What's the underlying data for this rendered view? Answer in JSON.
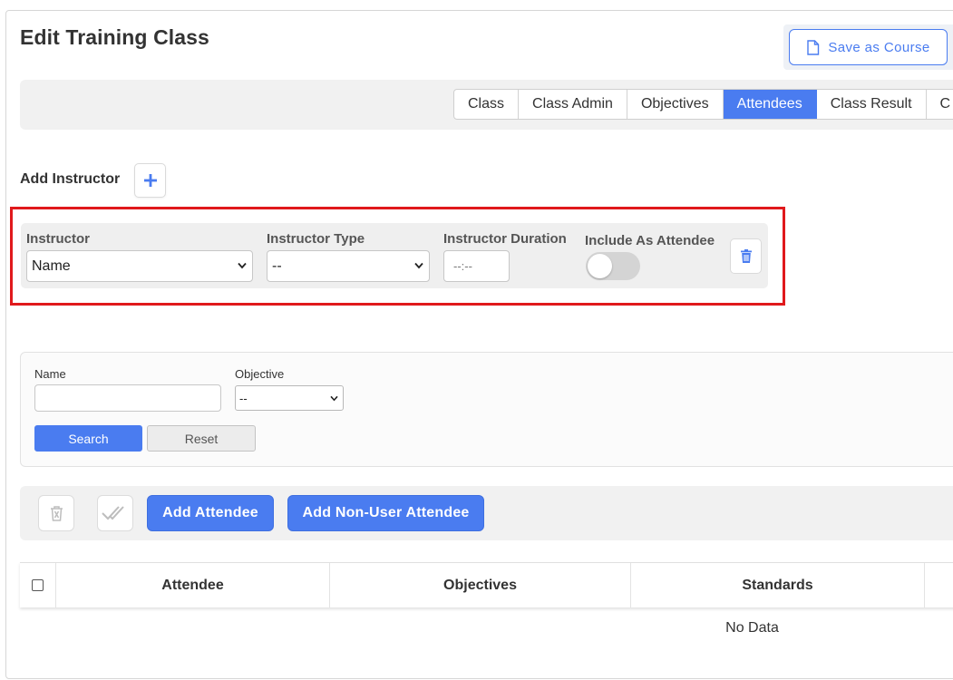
{
  "page": {
    "title": "Edit Training Class",
    "save_as_course_label": "Save as Course"
  },
  "tabs": [
    {
      "label": "Class",
      "active": false
    },
    {
      "label": "Class Admin",
      "active": false
    },
    {
      "label": "Objectives",
      "active": false
    },
    {
      "label": "Attendees",
      "active": true
    },
    {
      "label": "Class Result",
      "active": false
    },
    {
      "label": "C",
      "active": false
    }
  ],
  "instructor_section": {
    "add_label": "Add Instructor",
    "add_icon": "plus-icon",
    "instructor_label": "Instructor",
    "instructor_value": "Name",
    "type_label": "Instructor Type",
    "type_value": "--",
    "duration_label": "Instructor Duration",
    "duration_placeholder": "--:--",
    "include_label": "Include As Attendee",
    "include_value": false,
    "delete_icon": "trash-icon",
    "highlight_color": "#e0191c"
  },
  "filter": {
    "name_label": "Name",
    "name_value": "",
    "objective_label": "Objective",
    "objective_value": "--",
    "search_label": "Search",
    "reset_label": "Reset"
  },
  "actions": {
    "delete_icon": "trash-icon",
    "mark_complete_icon": "double-check-icon",
    "add_attendee_label": "Add Attendee",
    "add_non_user_label": "Add Non-User Attendee"
  },
  "table": {
    "columns": [
      "Attendee",
      "Objectives",
      "Standards"
    ],
    "empty_text": "No Data"
  },
  "colors": {
    "accent": "#4a7cf0",
    "highlight": "#e0191c"
  }
}
